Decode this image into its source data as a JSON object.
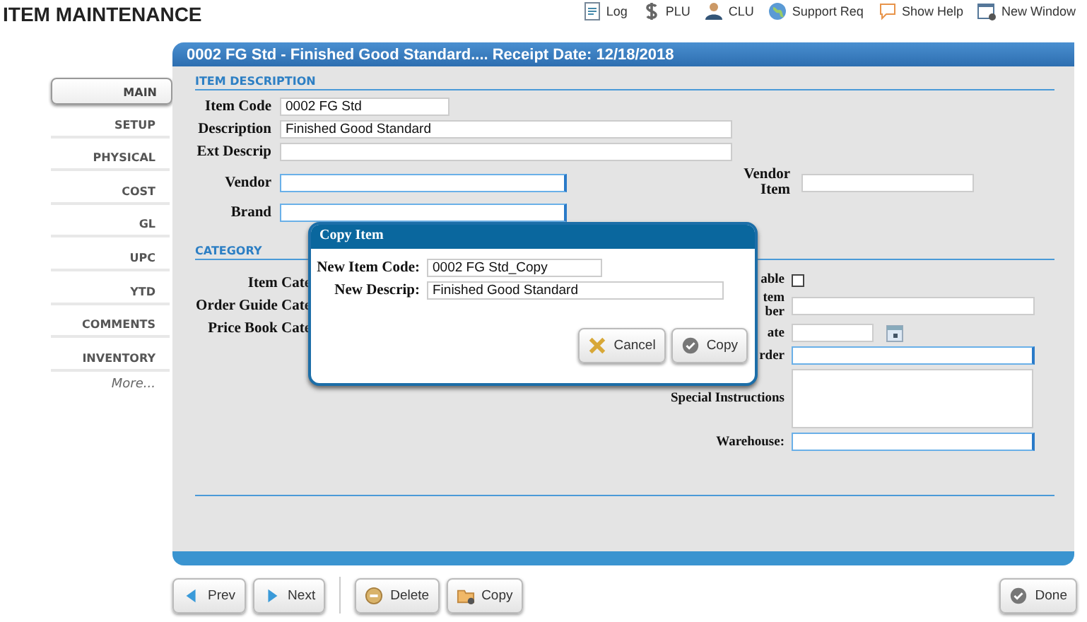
{
  "page_title": "ITEM MAINTENANCE",
  "toolbar": [
    {
      "label": "Log",
      "kind": "log"
    },
    {
      "label": "PLU",
      "kind": "dollar"
    },
    {
      "label": "CLU",
      "kind": "person"
    },
    {
      "label": "Support Req",
      "kind": "globe"
    },
    {
      "label": "Show Help",
      "kind": "bubble"
    },
    {
      "label": "New Window",
      "kind": "window"
    }
  ],
  "sidebar": {
    "items": [
      {
        "label": "MAIN",
        "selected": true
      },
      {
        "label": "SETUP",
        "selected": false
      },
      {
        "label": "PHYSICAL",
        "selected": false
      },
      {
        "label": "COST",
        "selected": false
      },
      {
        "label": "GL",
        "selected": false
      },
      {
        "label": "UPC",
        "selected": false
      },
      {
        "label": "YTD",
        "selected": false
      },
      {
        "label": "COMMENTS",
        "selected": false
      },
      {
        "label": "INVENTORY",
        "selected": false
      }
    ],
    "more": "More..."
  },
  "panel_title": "0002 FG Std - Finished Good Standard.... Receipt Date: 12/18/2018",
  "item_description": {
    "heading": "ITEM DESCRIPTION",
    "item_code": {
      "label": "Item Code",
      "value": "0002 FG Std"
    },
    "description": {
      "label": "Description",
      "value": "Finished Good Standard"
    },
    "ext_descrip": {
      "label": "Ext Descrip"
    },
    "vendor": {
      "label": "Vendor",
      "highlighted": true
    },
    "vendor_item": {
      "label": "Vendor Item",
      "highlighted": false
    },
    "brand": {
      "label": "Brand",
      "highlighted": true
    }
  },
  "category": {
    "heading": "CATEGORY",
    "left_labels": [
      "Item Cate",
      "Order Guide Cate",
      "Price Book Cate"
    ],
    "right_rows": [
      {
        "kind": "checkbox",
        "label": "able",
        "checked": false
      },
      {
        "kind": "field",
        "label": "tem\nber",
        "highlighted": false
      },
      {
        "kind": "date",
        "label": "ate",
        "highlighted": false
      },
      {
        "kind": "field",
        "label": "rder",
        "highlighted": true
      },
      {
        "kind": "textarea",
        "label": "Special Instructions",
        "highlighted": false
      },
      {
        "kind": "field",
        "label": "Warehouse:",
        "highlighted": true
      }
    ]
  },
  "buttons": [
    {
      "label": "Prev",
      "kind": "prev"
    },
    {
      "label": "Next",
      "kind": "next"
    },
    {
      "label": "Delete",
      "kind": "delete"
    },
    {
      "label": "Copy",
      "kind": "copy"
    }
  ],
  "done_button": {
    "label": "Done"
  },
  "dialog": {
    "title": "Copy Item",
    "fields": [
      {
        "label": "New Item Code:",
        "value": "0002 FG Std_Copy"
      },
      {
        "label": "New Descrip:",
        "value": "Finished Good Standard"
      }
    ],
    "buttons": [
      {
        "label": "Cancel",
        "kind": "cancel"
      },
      {
        "label": "Copy",
        "kind": "ok"
      }
    ]
  }
}
